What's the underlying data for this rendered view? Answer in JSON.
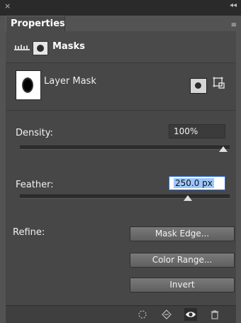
{
  "window": {
    "close_glyph": "×"
  },
  "tab": {
    "title": "Properties"
  },
  "header": {
    "title": "Masks"
  },
  "layer_mask": {
    "label": "Layer Mask"
  },
  "density": {
    "label": "Density:",
    "value": "100%",
    "level_percent": 100
  },
  "feather": {
    "label": "Feather:",
    "value": "250.0 px",
    "level_percent": 83
  },
  "refine": {
    "label": "Refine:"
  },
  "buttons": {
    "mask_edge": "Mask Edge...",
    "color_range": "Color Range...",
    "invert": "Invert"
  },
  "footer_icons": [
    "selection-from-mask-icon",
    "apply-mask-icon",
    "visibility-eye-icon",
    "trash-icon"
  ],
  "colors": {
    "accent": "#2c6bd6",
    "panel_bg": "#474747"
  }
}
